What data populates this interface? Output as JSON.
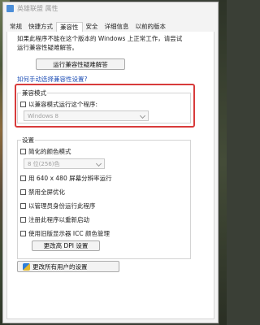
{
  "window": {
    "title": "英雄联盟 属性"
  },
  "tabs": [
    {
      "label": "常规"
    },
    {
      "label": "快捷方式"
    },
    {
      "label": "兼容性"
    },
    {
      "label": "安全"
    },
    {
      "label": "详细信息"
    },
    {
      "label": "以前的版本"
    }
  ],
  "intro": {
    "line1": "如果此程序不能在这个版本的 Windows 上正常工作，请尝试",
    "line2": "运行兼容性疑难解答。"
  },
  "troubleshooter_button": "运行兼容性疑难解答",
  "manual_link": "如何手动选择兼容性设置?",
  "compat_mode": {
    "group_label": "兼容模式",
    "checkbox_label": "以兼容模式运行这个程序:",
    "os_value": "Windows 8"
  },
  "settings": {
    "group_label": "设置",
    "reduced_color": "简化的颜色模式",
    "color_value": "8 位(256)色",
    "run_640": "用 640 x 480 屏幕分辨率运行",
    "disable_fullscreen": "禁用全屏优化",
    "run_admin": "以管理员身份运行此程序",
    "register_restart": "注册此程序以重新启动",
    "legacy_icc": "使用旧版显示器 ICC 颜色管理",
    "dpi_button": "更改高 DPI 设置"
  },
  "all_users_button": "更改所有用户的设置"
}
